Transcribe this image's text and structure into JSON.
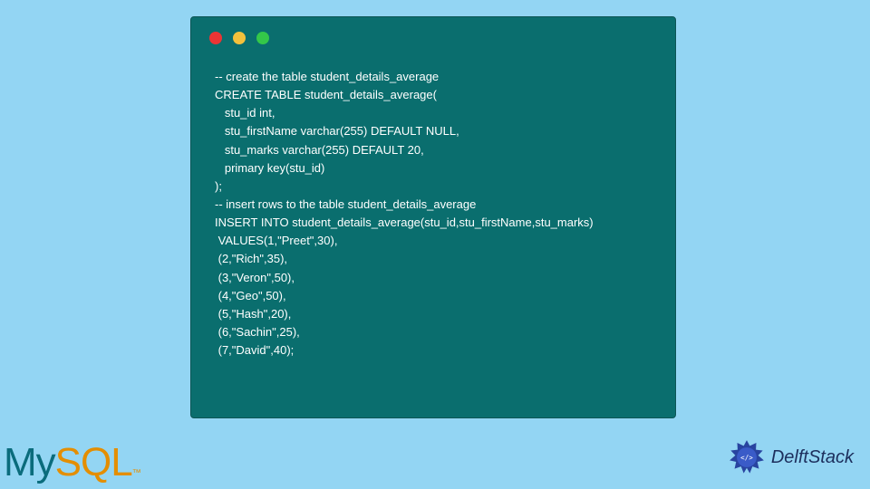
{
  "code": {
    "lines": [
      "-- create the table student_details_average",
      "CREATE TABLE student_details_average(",
      "   stu_id int,",
      "   stu_firstName varchar(255) DEFAULT NULL,",
      "   stu_marks varchar(255) DEFAULT 20,",
      "   primary key(stu_id)",
      ");",
      "-- insert rows to the table student_details_average",
      "INSERT INTO student_details_average(stu_id,stu_firstName,stu_marks)",
      " VALUES(1,\"Preet\",30),",
      " (2,\"Rich\",35),",
      " (3,\"Veron\",50),",
      " (4,\"Geo\",50),",
      " (5,\"Hash\",20),",
      " (6,\"Sachin\",25),",
      " (7,\"David\",40);"
    ]
  },
  "logos": {
    "mysql": {
      "part1": "My",
      "part2": "SQL",
      "tm": "™"
    },
    "delft": {
      "text": "DelftStack"
    }
  }
}
